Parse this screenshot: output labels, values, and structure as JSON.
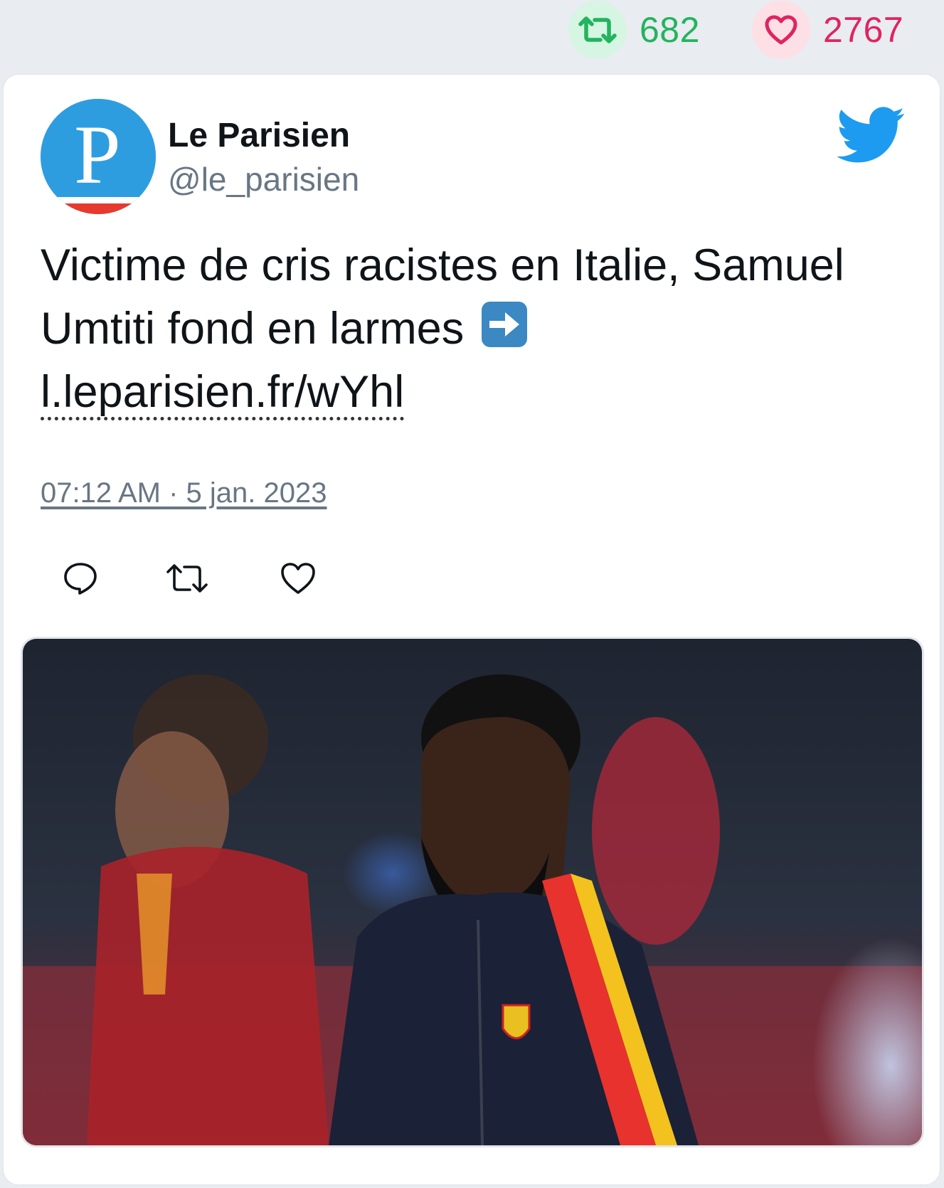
{
  "stats": {
    "retweet_icon": "retweet-icon",
    "retweet_count": "682",
    "like_icon": "heart-icon",
    "like_count": "2767",
    "retweet_color": "#22b45e",
    "like_color": "#e0245e"
  },
  "tweet": {
    "display_name": "Le Parisien",
    "handle": "@le_parisien",
    "avatar_letter": "P",
    "text": "Victime de cris racistes en Italie, Samuel Umtiti fond en larmes",
    "emoji": "arrow-right-emoji",
    "link": "l.leparisien.fr/wYhl",
    "timestamp": "07:12 AM · 5 jan. 2023",
    "brand_color": "#1d9bf0"
  },
  "actions": {
    "reply_icon": "reply-icon",
    "retweet_icon": "retweet-icon",
    "like_icon": "heart-icon"
  },
  "media": {
    "kind": "photo",
    "subject_icon": "football-player-photo"
  }
}
